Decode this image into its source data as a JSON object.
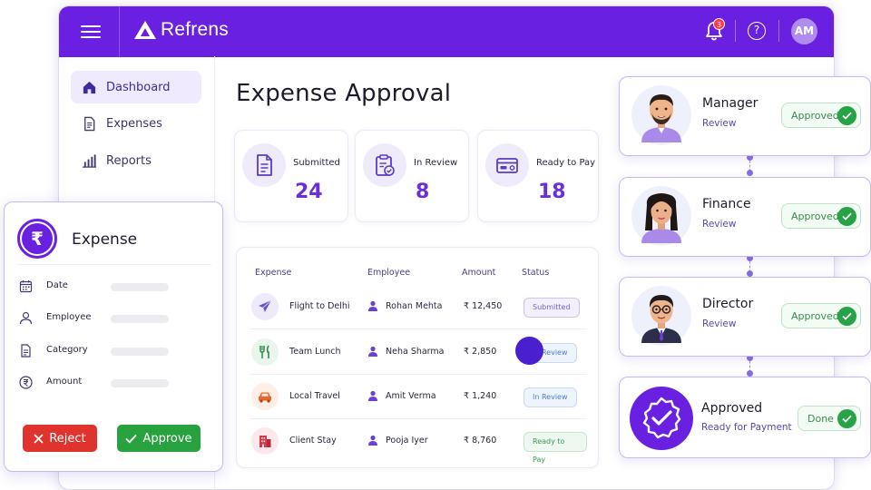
{
  "brand": {
    "name": "Refrens"
  },
  "topbar": {
    "notification_count": "3",
    "help_label": "?",
    "avatar_initials": "AM"
  },
  "sidebar": {
    "items": [
      {
        "label": "Dashboard",
        "icon": "home-icon",
        "active": true
      },
      {
        "label": "Expenses",
        "icon": "document-icon",
        "active": false
      },
      {
        "label": "Reports",
        "icon": "bar-chart-icon",
        "active": false
      }
    ]
  },
  "page": {
    "title": "Expense Approval"
  },
  "stats": [
    {
      "label": "Submitted",
      "value": "24",
      "icon": "file-icon"
    },
    {
      "label": "In Review",
      "value": "8",
      "icon": "clipboard-check-icon"
    },
    {
      "label": "Ready to Pay",
      "value": "18",
      "icon": "payment-card-icon"
    }
  ],
  "table": {
    "headers": [
      "Expense",
      "Employee",
      "Amount",
      "Status"
    ],
    "rows": [
      {
        "expense": "Flight to Delhi",
        "icon": "plane-icon",
        "employee": "Rohan Mehta",
        "amount": "₹ 12,450",
        "status": "Submitted",
        "status_type": "submitted"
      },
      {
        "expense": "Team Lunch",
        "icon": "utensils-icon",
        "employee": "Neha Sharma",
        "amount": "₹ 2,850",
        "status": "In Review",
        "status_type": "review"
      },
      {
        "expense": "Local Travel",
        "icon": "car-icon",
        "employee": "Amit Verma",
        "amount": "₹ 1,240",
        "status": "In Review",
        "status_type": "review"
      },
      {
        "expense": "Client Stay",
        "icon": "building-icon",
        "employee": "Pooja Iyer",
        "amount": "₹ 8,760",
        "status": "Ready to Pay",
        "status_type": "ready"
      }
    ]
  },
  "expense_panel": {
    "title": "Expense",
    "logo_symbol": "₹",
    "fields": [
      {
        "label": "Date",
        "icon": "calendar-icon"
      },
      {
        "label": "Employee",
        "icon": "user-icon"
      },
      {
        "label": "Category",
        "icon": "document-icon"
      },
      {
        "label": "Amount",
        "icon": "rupee-icon"
      }
    ],
    "reject_label": "Reject",
    "approve_label": "Approve"
  },
  "workflow": [
    {
      "title": "Manager",
      "subtitle": "Review",
      "status": "Approved"
    },
    {
      "title": "Finance",
      "subtitle": "Review",
      "status": "Approved"
    },
    {
      "title": "Director",
      "subtitle": "Review",
      "status": "Approved"
    },
    {
      "title": "Approved",
      "subtitle": "Ready for Payment",
      "status": "Done"
    }
  ],
  "colors": {
    "brand": "#6a20e0",
    "accent_value": "#6a2fd8",
    "reject": "#e0332d",
    "approve": "#27a23e"
  }
}
